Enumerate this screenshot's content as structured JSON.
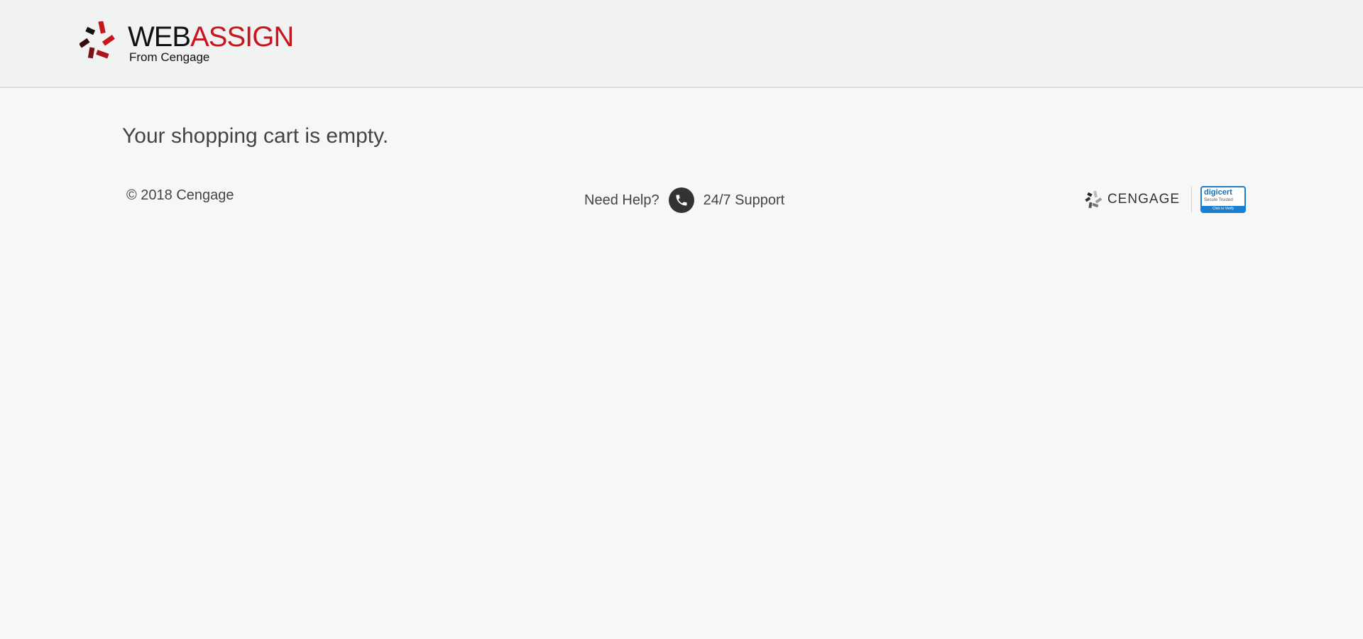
{
  "header": {
    "logo": {
      "word_web": "WEB",
      "word_assign": "ASSIGN",
      "subtitle": "From Cengage",
      "icon": "webassign-logo-icon"
    }
  },
  "main": {
    "cart_message": "Your shopping cart is empty."
  },
  "footer": {
    "copyright": "© 2018 Cengage",
    "help_label": "Need Help?",
    "phone_icon": "phone-icon",
    "support_link": "24/7 Support",
    "cengage_logo_text": "CENGAGE",
    "digicert": {
      "brand": "digicert",
      "tagline": "Secure Trusted",
      "action": "Click to Verify"
    }
  },
  "colors": {
    "brand_red": "#c8161d",
    "header_bg": "#f1f2f2",
    "page_bg": "#f7f7f7",
    "digicert_blue": "#1a7fd0"
  }
}
